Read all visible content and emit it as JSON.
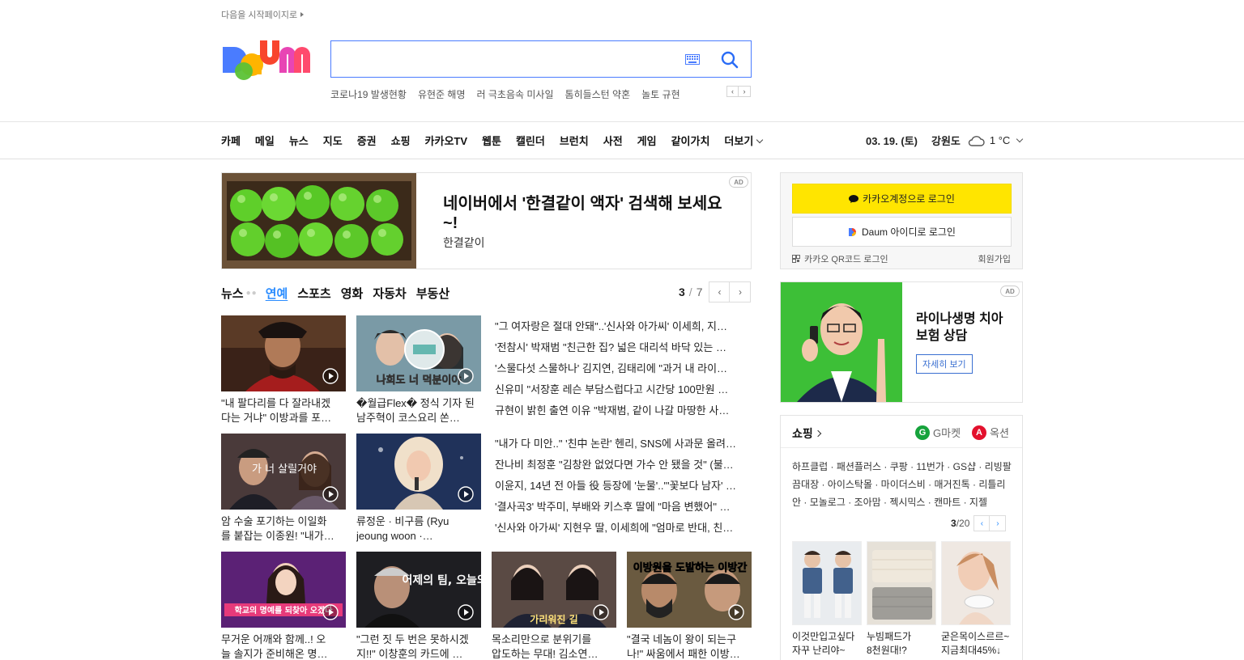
{
  "top": {
    "set_start": "다음을 시작페이지로"
  },
  "search": {
    "placeholder": "",
    "value": ""
  },
  "trending": [
    "코로나19 발생현황",
    "유현준 해명",
    "러 극초음속 미사일",
    "톰히들스턴 약혼",
    "놀토 규현"
  ],
  "gnb": {
    "items": [
      "카페",
      "메일",
      "뉴스",
      "지도",
      "증권",
      "쇼핑",
      "카카오TV",
      "웹툰",
      "캘린더",
      "브런치",
      "사전",
      "게임",
      "같이가치"
    ],
    "more": "더보기"
  },
  "weather": {
    "date": "03. 19. (토)",
    "region": "강원도",
    "temp": "1 °C",
    "icon": "cloud-icon"
  },
  "ad_banner": {
    "badge": "AD",
    "title": "네이버에서 '한결같이 액자' 검색해 보세요~!",
    "subtitle": "한결같이"
  },
  "news": {
    "label": "뉴스",
    "tabs": [
      "연예",
      "스포츠",
      "영화",
      "자동차",
      "부동산"
    ],
    "active_tab": "연예",
    "page_current": "3",
    "page_sep": "/",
    "page_total": "7",
    "thumbs_row1": [
      {
        "line1": "\"내 팔다리를 다 잘라내겠",
        "line2": "다는 거냐\" 이방과를 포…"
      },
      {
        "line1": "�월급Flex� 정식 기자 된",
        "line2": "남주혁이 코스요리 쏜…"
      }
    ],
    "thumbs_row2": [
      {
        "line1": "암 수술 포기하는 이일화",
        "line2": "를 붙잡는 이종원! \"내가…"
      },
      {
        "line1": "류정운 · 비구름 (Ryu",
        "line2": "jeoung woon ·…"
      }
    ],
    "thumbs_row3": [
      {
        "line1": "무거운 어깨와 함께..! 오",
        "line2": "늘 솔지가 준비해온 명…"
      },
      {
        "line1": "\"그런 짓 두 번은 못하시겠",
        "line2": "지!!\" 이창훈의 카드에 …"
      },
      {
        "line1": "목소리만으로 분위기를",
        "line2": "압도하는 무대! 김소연…"
      },
      {
        "line1": "\"결국 네놈이 왕이 되는구",
        "line2": "나!\" 싸움에서 패한 이방…"
      }
    ],
    "list1": [
      "\"그 여자랑은 절대 안돼\"..'신사와 아가씨' 이세희, 지…",
      "'전참시' 박재범 \"친근한 집? 넓은 대리석 바닥 있는 …",
      "'스물다섯 스물하나' 김지연, 김태리에 \"과거 내 라이…",
      "신유미 \"서장훈 레슨 부담스럽다고 시간당 100만원 …",
      "규현이 밝힌 출연 이유 \"박재범, 같이 나갈 마땅한 사…"
    ],
    "list2": [
      "\"내가 다 미안..\" '친中 논란' 헨리, SNS에 사과문 올려…",
      "잔나비 최정훈 \"김창완 없었다면 가수 안 됐을 것\" (불…",
      "이윤지, 14년 전 아들 役 등장에 '눈물'..\"'꽃보다 남자' …",
      "'결사곡3' 박주미, 부배와 키스후 딸에 \"마음 변했어\" …",
      "'신사와 아가씨' 지현우 딸, 이세희에 \"엄마로 반대, 친…"
    ],
    "thumb_text": [
      "나희도 너 덕분이야",
      "가 너 살릴거야",
      "학교의 명예를 되찾아 오겠다",
      "어제의 팀, 오늘의 적",
      "가리워진 길",
      "이방원을 도발하는 이방간"
    ]
  },
  "login": {
    "kakao": "카카오계정으로 로그인",
    "daum": "Daum 아이디로 로그인",
    "qr": "카카오 QR코드 로그인",
    "signup": "회원가입"
  },
  "ad2": {
    "badge": "AD",
    "title": "라이나생명 치아보험 상담",
    "button": "자세히 보기"
  },
  "shopping": {
    "title": "쇼핑",
    "gmarket": "G마켓",
    "auction": "옥션",
    "links": "하프클럽 · 패션플러스 · 쿠팡 · 11번가 · GS샵 · 리빙팔끔대장 · 아이스탁몰 · 마이더스비 · 매거진톡 · 리틀리안 · 모놀로그 · 조아맘 · 젝시믹스 · 캔마트 · 지젤",
    "page_current": "3",
    "page_total": "/20",
    "products": [
      {
        "line1": "이것만입고싶다",
        "line2": "자꾸 난리야~"
      },
      {
        "line1": "누빔패드가",
        "line2": "8천원대!?"
      },
      {
        "line1": "굳은목이스르르~",
        "line2": "지금최대45%↓"
      }
    ]
  },
  "colors": {
    "accent": "#2a8cff",
    "kakao_yellow": "#ffe500",
    "search_border": "#4a7cff"
  }
}
